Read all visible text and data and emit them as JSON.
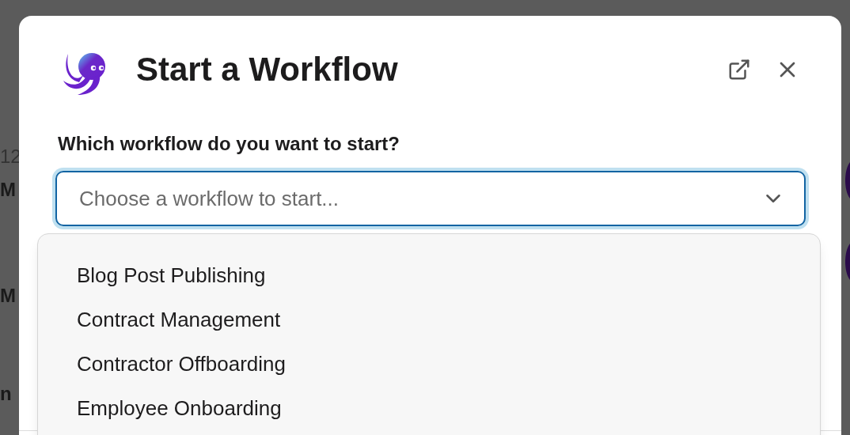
{
  "background": {
    "texts": [
      {
        "text": "12",
        "bold": false
      },
      {
        "text": "M",
        "bold": true
      },
      {
        "text": "M",
        "bold": true
      },
      {
        "text": "n",
        "bold": true
      }
    ]
  },
  "dialog": {
    "title": "Start a Workflow",
    "question": "Which workflow do you want to start?",
    "select": {
      "placeholder": "Choose a workflow to start...",
      "expanded": true
    },
    "options": [
      {
        "label": "Blog Post Publishing"
      },
      {
        "label": "Contract Management"
      },
      {
        "label": "Contractor Offboarding"
      },
      {
        "label": "Employee Onboarding"
      }
    ]
  }
}
